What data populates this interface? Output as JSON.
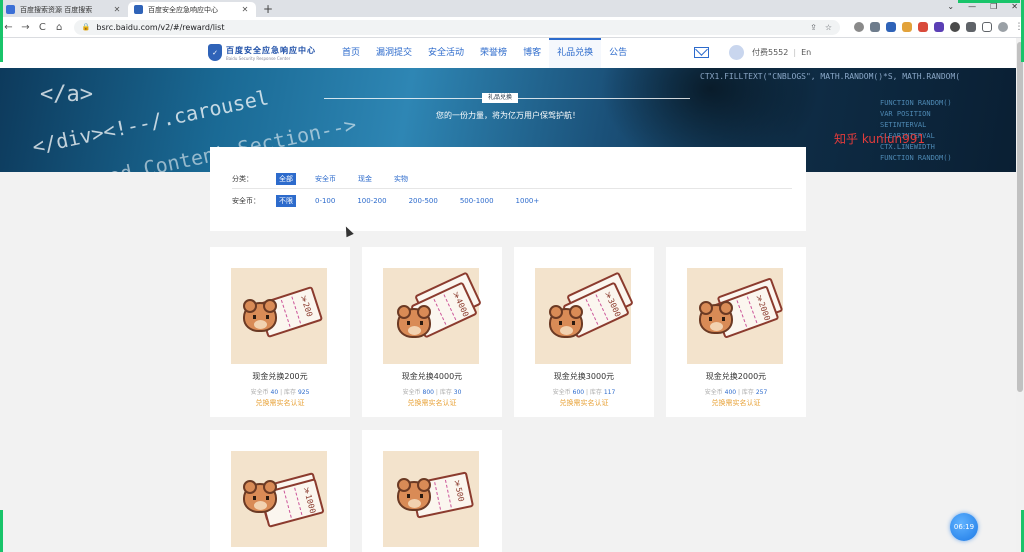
{
  "browser": {
    "tabs": [
      {
        "title": "百度搜索资源 百度搜索",
        "favicon_color": "#3b6fd6",
        "active": false
      },
      {
        "title": "百度安全应急响应中心",
        "favicon_color": "#2f63b8",
        "active": true
      }
    ],
    "new_tab": "+",
    "window_controls": [
      "⌄",
      "—",
      "❐",
      "✕"
    ],
    "url": "bsrc.baidu.com/v2/#/reward/list",
    "nav_buttons": [
      "←",
      "→",
      "C",
      "⌂"
    ]
  },
  "site": {
    "logo": {
      "cn": "百度安全应急响应中心",
      "en": "Baidu Security Response Center"
    },
    "nav": [
      {
        "label": "首页",
        "active": false
      },
      {
        "label": "漏洞提交",
        "active": false
      },
      {
        "label": "安全活动",
        "active": false
      },
      {
        "label": "荣誉榜",
        "active": false
      },
      {
        "label": "博客",
        "active": false
      },
      {
        "label": "礼品兑换",
        "active": true
      },
      {
        "label": "公告",
        "active": false
      }
    ],
    "user": "付费5552",
    "lang": "En",
    "lang_sep": "|"
  },
  "banner": {
    "tag": "礼品兑换",
    "subtitle": "您的一份力量，将为亿万用户保驾护航！",
    "watermark": "知乎 kunlun991",
    "code1": "</a>",
    "code2": "</div><!--/.carousel",
    "code3": "tured Content Section-->",
    "code4": "CTX1.FILLTEXT(\"CNBLOGS\", MATH.RANDOM()*S, MATH.RANDOM(",
    "code5": "FUNCTION RANDOM()\nVAR POSITION\nSETINTERVAL\nCLEARINTERVAL\nCTX.LINEWIDTH\nFUNCTION RANDOM()"
  },
  "filter": {
    "category_label": "分类：",
    "categories": [
      {
        "label": "全部",
        "selected": true
      },
      {
        "label": "安全币",
        "selected": false
      },
      {
        "label": "现金",
        "selected": false
      },
      {
        "label": "实物",
        "selected": false
      }
    ],
    "coin_label": "安全币：",
    "coins": [
      {
        "label": "不限",
        "selected": true
      },
      {
        "label": "0-100",
        "selected": false
      },
      {
        "label": "100-200",
        "selected": false
      },
      {
        "label": "200-500",
        "selected": false
      },
      {
        "label": "500-1000",
        "selected": false
      },
      {
        "label": "1000+",
        "selected": false
      }
    ]
  },
  "products": [
    {
      "name": "现金兑换200元",
      "amount": "￥200",
      "coin_label": "安全币",
      "coin": "40",
      "stock_label": "库存",
      "stock": "925",
      "req": "兑换需实名认证"
    },
    {
      "name": "现金兑换4000元",
      "amount": "￥4000",
      "coin_label": "安全币",
      "coin": "800",
      "stock_label": "库存",
      "stock": "30",
      "req": "兑换需实名认证"
    },
    {
      "name": "现金兑换3000元",
      "amount": "￥3000",
      "coin_label": "安全币",
      "coin": "600",
      "stock_label": "库存",
      "stock": "117",
      "req": "兑换需实名认证"
    },
    {
      "name": "现金兑换2000元",
      "amount": "￥2000",
      "coin_label": "安全币",
      "coin": "400",
      "stock_label": "库存",
      "stock": "257",
      "req": "兑换需实名认证"
    },
    {
      "name": "",
      "amount": "￥1000",
      "coin_label": "",
      "coin": "",
      "stock_label": "",
      "stock": "",
      "req": ""
    },
    {
      "name": "",
      "amount": "￥500",
      "coin_label": "",
      "coin": "",
      "stock_label": "",
      "stock": "",
      "req": ""
    }
  ],
  "timer": "06:19",
  "colors": {
    "accent": "#2d6bcc",
    "warning": "#e8a33a",
    "card_bg": "#f3e3cc",
    "bill_ink": "#8b3b2e"
  }
}
